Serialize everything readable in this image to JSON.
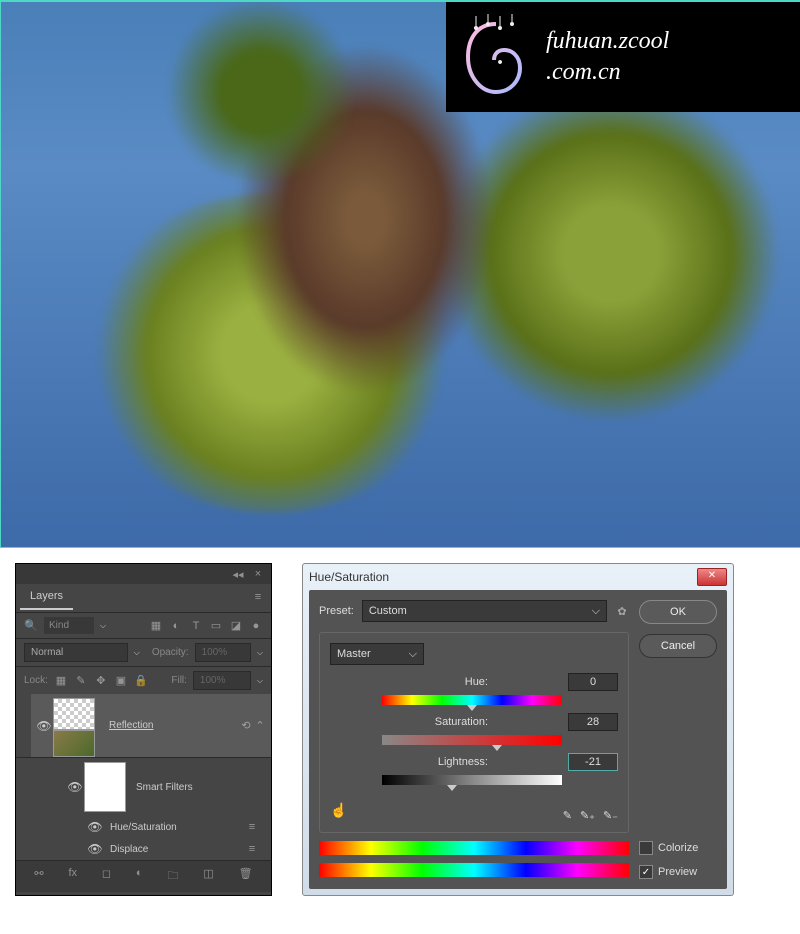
{
  "watermark": {
    "line1": "fuhuan.zcool",
    "line2": ".com.cn"
  },
  "layers_panel": {
    "tab": "Layers",
    "search_placeholder": "Kind",
    "blend_mode": "Normal",
    "opacity_label": "Opacity:",
    "opacity_value": "100%",
    "lock_label": "Lock:",
    "fill_label": "Fill:",
    "fill_value": "100%",
    "layer_name": "Reflection",
    "smart_filters_label": "Smart Filters",
    "filters": [
      {
        "name": "Hue/Saturation"
      },
      {
        "name": "Displace"
      }
    ]
  },
  "hue_sat": {
    "title": "Hue/Saturation",
    "preset_label": "Preset:",
    "preset_value": "Custom",
    "channel_value": "Master",
    "hue_label": "Hue:",
    "hue_value": "0",
    "saturation_label": "Saturation:",
    "saturation_value": "28",
    "lightness_label": "Lightness:",
    "lightness_value": "-21",
    "ok_label": "OK",
    "cancel_label": "Cancel",
    "colorize_label": "Colorize",
    "preview_label": "Preview",
    "preview_checked": "✓"
  }
}
